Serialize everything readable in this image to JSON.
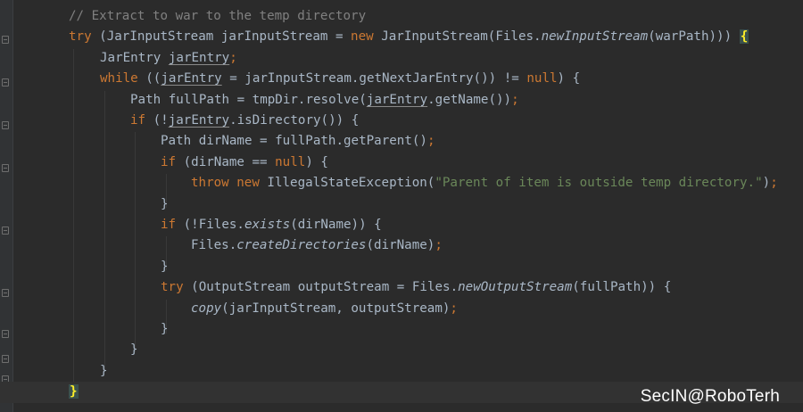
{
  "editor": {
    "lines": [
      {
        "id": "l1",
        "segments": [
          {
            "t": "// Extract to war to the temp directory",
            "c": "cm"
          }
        ]
      },
      {
        "id": "l2",
        "segments": [
          {
            "t": "try",
            "c": "kw"
          },
          {
            "t": " (JarInputStream jarInputStream = ",
            "c": "tx"
          },
          {
            "t": "new",
            "c": "kw"
          },
          {
            "t": " JarInputStream(Files.",
            "c": "tx"
          },
          {
            "t": "newInputStream",
            "c": "it"
          },
          {
            "t": "(warPath))) ",
            "c": "tx"
          },
          {
            "t": "{",
            "c": "br"
          }
        ]
      },
      {
        "id": "l3",
        "segments": [
          {
            "t": "JarEntry ",
            "c": "tx"
          },
          {
            "t": "jarEntry",
            "c": "sq"
          },
          {
            "t": ";",
            "c": "kw"
          }
        ]
      },
      {
        "id": "l4",
        "segments": [
          {
            "t": "while",
            "c": "kw"
          },
          {
            "t": " ((",
            "c": "tx"
          },
          {
            "t": "jarEntry",
            "c": "sq"
          },
          {
            "t": " = jarInputStream.getNextJarEntry()) != ",
            "c": "tx"
          },
          {
            "t": "null",
            "c": "kw"
          },
          {
            "t": ") {",
            "c": "tx"
          }
        ]
      },
      {
        "id": "l5",
        "segments": [
          {
            "t": "Path fullPath = tmpDir.resolve(",
            "c": "tx"
          },
          {
            "t": "jarEntry",
            "c": "sq"
          },
          {
            "t": ".getName())",
            "c": "tx"
          },
          {
            "t": ";",
            "c": "kw"
          }
        ]
      },
      {
        "id": "l6",
        "segments": [
          {
            "t": "if",
            "c": "kw"
          },
          {
            "t": " (!",
            "c": "tx"
          },
          {
            "t": "jarEntry",
            "c": "sq"
          },
          {
            "t": ".isDirectory()) {",
            "c": "tx"
          }
        ]
      },
      {
        "id": "l7",
        "segments": [
          {
            "t": "Path dirName = fullPath.getParent()",
            "c": "tx"
          },
          {
            "t": ";",
            "c": "kw"
          }
        ]
      },
      {
        "id": "l8",
        "segments": [
          {
            "t": "if",
            "c": "kw"
          },
          {
            "t": " (dirName == ",
            "c": "tx"
          },
          {
            "t": "null",
            "c": "kw"
          },
          {
            "t": ") {",
            "c": "tx"
          }
        ]
      },
      {
        "id": "l9",
        "segments": [
          {
            "t": "throw new",
            "c": "kw"
          },
          {
            "t": " IllegalStateException(",
            "c": "tx"
          },
          {
            "t": "\"Parent of item is outside temp directory.\"",
            "c": "str"
          },
          {
            "t": ")",
            "c": "tx"
          },
          {
            "t": ";",
            "c": "kw"
          }
        ]
      },
      {
        "id": "l10",
        "segments": [
          {
            "t": "}",
            "c": "tx"
          }
        ]
      },
      {
        "id": "l11",
        "segments": [
          {
            "t": "if",
            "c": "kw"
          },
          {
            "t": " (!Files.",
            "c": "tx"
          },
          {
            "t": "exists",
            "c": "it"
          },
          {
            "t": "(dirName)) {",
            "c": "tx"
          }
        ]
      },
      {
        "id": "l12",
        "segments": [
          {
            "t": "Files.",
            "c": "tx"
          },
          {
            "t": "createDirectories",
            "c": "it"
          },
          {
            "t": "(dirName)",
            "c": "tx"
          },
          {
            "t": ";",
            "c": "kw"
          }
        ]
      },
      {
        "id": "l13",
        "segments": [
          {
            "t": "}",
            "c": "tx"
          }
        ]
      },
      {
        "id": "l14",
        "segments": [
          {
            "t": "try",
            "c": "kw"
          },
          {
            "t": " (OutputStream outputStream = Files.",
            "c": "tx"
          },
          {
            "t": "newOutputStream",
            "c": "it"
          },
          {
            "t": "(fullPath)) {",
            "c": "tx"
          }
        ]
      },
      {
        "id": "l15",
        "segments": [
          {
            "t": "copy",
            "c": "it"
          },
          {
            "t": "(jarInputStream, outputStream)",
            "c": "tx"
          },
          {
            "t": ";",
            "c": "kw"
          }
        ]
      },
      {
        "id": "l16",
        "segments": [
          {
            "t": "}",
            "c": "tx"
          }
        ]
      },
      {
        "id": "l17",
        "segments": [
          {
            "t": "}",
            "c": "tx"
          }
        ]
      },
      {
        "id": "l18",
        "segments": [
          {
            "t": "}",
            "c": "tx"
          }
        ]
      },
      {
        "id": "l19",
        "segments": [
          {
            "t": "}",
            "c": "br"
          }
        ]
      }
    ]
  },
  "watermark": "SecIN@RoboTerh",
  "colors": {
    "background": "#2b2b2b",
    "keyword": "#cc7832",
    "comment": "#808080",
    "string": "#6a8759",
    "text": "#a9b7c6",
    "brace_match": "#ffef28"
  }
}
